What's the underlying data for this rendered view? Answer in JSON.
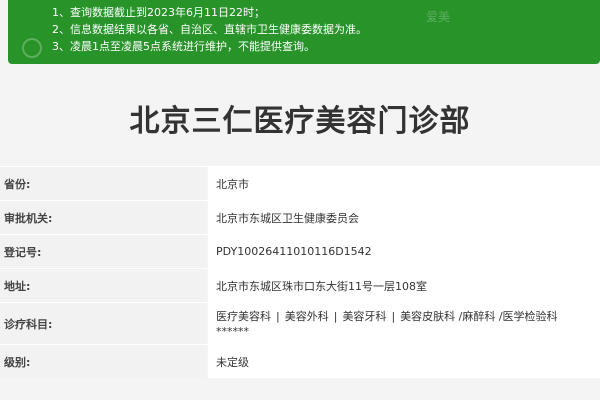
{
  "notice": {
    "lines": [
      "1、查询数据截止到2023年6月11日22时；",
      "2、信息数据结果以各省、自治区、直辖市卫生健康委数据为准。",
      "3、凌晨1点至凌晨5点系统进行维护，不能提供查询。"
    ],
    "watermark": "爱美",
    "background": "#279329"
  },
  "page_title": "北京三仁医疗美容门诊部",
  "rows": [
    {
      "label": "省份:",
      "value": "北京市"
    },
    {
      "label": "审批机关:",
      "value": "北京市东城区卫生健康委员会"
    },
    {
      "label": "登记号:",
      "value": "PDY10026411010116D1542"
    },
    {
      "label": "地址:",
      "value": "北京市东城区珠市口东大街11号一层108室"
    },
    {
      "label": "诊疗科目:",
      "value_line1_items": [
        "医疗美容科",
        "美容外科",
        "美容牙科",
        "美容皮肤科 /麻醉科 /医学检验科"
      ],
      "value_line2": "******"
    },
    {
      "label": "级别:",
      "value": "未定级"
    }
  ],
  "separator": "|"
}
